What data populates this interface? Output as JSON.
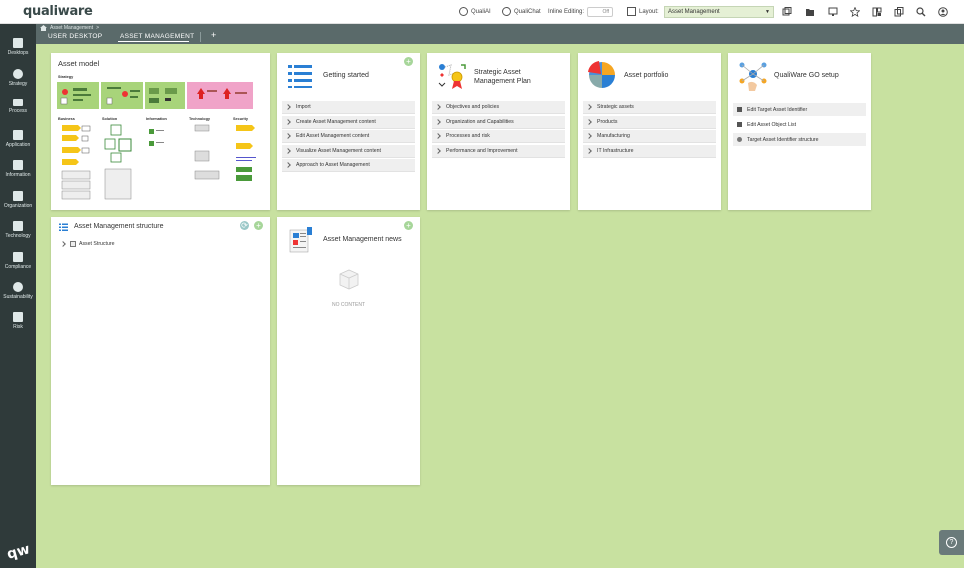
{
  "app": {
    "logo_text": "qualiware",
    "corner_logo_text": "qw"
  },
  "topbar": {
    "qualiai_label": "QualiAI",
    "qualichat_label": "QualiChat",
    "inline_editing_label": "Inline Editing:",
    "inline_editing_value": "Off",
    "layout_label": "Layout:",
    "layout_value": "Asset Management",
    "icons": [
      "qualiai-icon",
      "qualichat-icon",
      "layout-grid-icon",
      "share-icon",
      "folder-icon",
      "monitor-icon",
      "star-icon",
      "dashboard-icon",
      "copy-icon",
      "search-icon",
      "user-icon"
    ]
  },
  "sidebar": {
    "items": [
      {
        "label": "Desktops",
        "icon": "desktops-icon"
      },
      {
        "label": "Strategy",
        "icon": "strategy-icon"
      },
      {
        "label": "Process",
        "icon": "process-icon"
      },
      {
        "label": "Application",
        "icon": "application-icon"
      },
      {
        "label": "Information",
        "icon": "information-icon"
      },
      {
        "label": "Organization",
        "icon": "organization-icon"
      },
      {
        "label": "Technology",
        "icon": "technology-icon"
      },
      {
        "label": "Compliance",
        "icon": "compliance-icon"
      },
      {
        "label": "Sustainability",
        "icon": "sustainability-icon"
      },
      {
        "label": "Risk",
        "icon": "risk-icon"
      }
    ]
  },
  "breadcrumb": {
    "text": "Asset Management",
    "separator": ">"
  },
  "tabs": [
    {
      "label": "USER DESKTOP",
      "active": false
    },
    {
      "label": "ASSET MANAGEMENT",
      "active": true
    }
  ],
  "tab_add_label": "+",
  "cards": {
    "asset_model": {
      "title": "Asset model",
      "section_strategy": "Strategy",
      "columns": [
        "Business",
        "Solution",
        "Information",
        "Technology",
        "Security"
      ]
    },
    "getting_started": {
      "title": "Getting started",
      "links": [
        "Import",
        "Create Asset Management content",
        "Edit Asset Management content",
        "Visualize Asset Management content",
        "Approach to Asset Management"
      ]
    },
    "strategic_plan": {
      "title_line1": "Strategic Asset",
      "title_line2": "Management Plan",
      "links": [
        "Objectives and policies",
        "Organization and Capabilities",
        "Processes and risk",
        "Performance and Improvement"
      ]
    },
    "asset_portfolio": {
      "title": "Asset portfolio",
      "links": [
        "Strategic assets",
        "Products",
        "Manufacturing",
        "IT Infrastructure"
      ]
    },
    "go_setup": {
      "title": "QualiWare GO setup",
      "links": [
        "Edit Target Asset Identifier",
        "Edit Asset Object List",
        "Target Asset Identifier structure"
      ]
    },
    "structure": {
      "title": "Asset Management structure",
      "tree_item": "Asset Structure"
    },
    "news": {
      "title": "Asset Management news",
      "empty_text": "NO CONTENT"
    }
  },
  "help_button_label": "?",
  "colors": {
    "desktop_bg": "#c8e1a0",
    "sidebar_bg": "#2f3a3a",
    "tabbar_bg": "#5a6a6a",
    "accent_blue": "#2a7fd4",
    "add_button": "#a7d69a"
  }
}
